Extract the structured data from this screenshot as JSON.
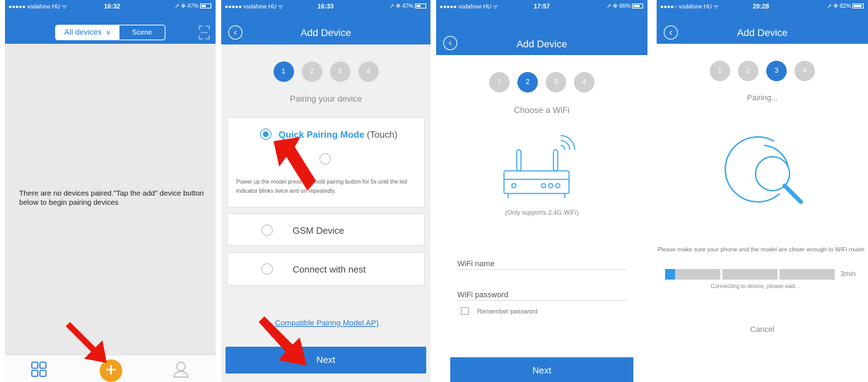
{
  "screen1": {
    "status": {
      "carrier": "●●●●● vodafone HU ᯤ",
      "time": "16:32",
      "battery": "➚ ✻ 47%"
    },
    "segment": {
      "all_devices": "All devices",
      "scene": "Scene"
    },
    "empty_message": "There are no devices paired.\"Tap the add\" device button below to begin pairing devices"
  },
  "screen2": {
    "status": {
      "carrier": "●●●●● vodafone HU ᯤ",
      "time": "16:33",
      "battery": "➚ ✻ 47%"
    },
    "title": "Add Device",
    "steps": [
      "1",
      "2",
      "3",
      "4"
    ],
    "subtitle": "Pairing your device",
    "quick_mode_label": "Quick Pairing Mode",
    "quick_mode_suffix": "(Touch)",
    "quick_mode_desc": "Power up the model press and hold pairing button for 5s until the led indicator blinks twice and on repeatedly.",
    "gsm_label": "GSM Device",
    "nest_label": "Connect with nest",
    "compat_link": "Compatible Pairing Model AP)",
    "next_label": "Next"
  },
  "screen3": {
    "status": {
      "carrier": "●●●●● vodafone HU ᯤ",
      "time": "17:57",
      "battery": "➚ ✻ 66%"
    },
    "title": "Add Device",
    "steps": [
      "1",
      "2",
      "3",
      "4"
    ],
    "subtitle": "Choose a WiFi",
    "wifi_note": "(Only supports 2.4G WiFi)",
    "wifi_name_label": "WiFi name",
    "wifi_password_label": "WiFi password",
    "remember_label": "Remember password",
    "next_label": "Next"
  },
  "screen4": {
    "status": {
      "carrier": "●●●●○ vodafone HU ᯤ",
      "time": "20:28",
      "battery": "➚ ✻ 82%"
    },
    "title": "Add Device",
    "steps": [
      "1",
      "2",
      "3",
      "4"
    ],
    "subtitle": "Pairing...",
    "hint": "Please make sure your phone and the model are closer enough to WiFi router.",
    "progress": {
      "fraction": 0.06,
      "time_left": "3min"
    },
    "connecting": "Connecting to device, please wait...",
    "cancel_label": "Cancel"
  },
  "colors": {
    "accent": "#2a7bd5",
    "highlight": "#2f9be8",
    "fab": "#f0a020",
    "arrow": "#e8160c"
  }
}
